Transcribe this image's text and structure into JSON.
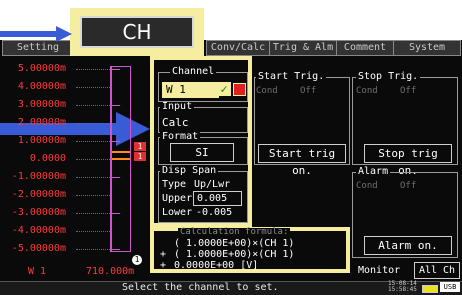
{
  "ch_button": {
    "label": "CH"
  },
  "tabs": [
    {
      "label": "Setting"
    },
    {
      "label": "Conv/Calc"
    },
    {
      "label": "Trig & Alm"
    },
    {
      "label": "Comment"
    },
    {
      "label": "System"
    }
  ],
  "y_axis": {
    "labels": [
      "5.00000m",
      "4.00000m",
      "3.00000m",
      "2.00000m",
      "1.00000m",
      "0.0000",
      "-1.00000m",
      "-2.00000m",
      "-3.00000m",
      "-4.00000m",
      "-5.00000m"
    ]
  },
  "trace": {
    "channel_label": "W 1",
    "value": "710.000m"
  },
  "markers": {
    "marker_1": "1",
    "marker_2": "1",
    "bottom_marker": "1"
  },
  "channel_panel": {
    "legend": "Channel",
    "value": "W  1",
    "check_glyph": "✓",
    "input_legend": "Input",
    "input_value": "Calc",
    "format_legend": "Format",
    "format_value": "SI",
    "disp_span_legend": "Disp Span",
    "type_label": "Type",
    "type_value": "Up/Lwr",
    "upper_label": "Upper",
    "upper_value": "0.005",
    "lower_label": "Lower",
    "lower_value": "-0.005"
  },
  "start_trig": {
    "legend": "Start Trig.",
    "cond_label": "Cond",
    "cond_value": "Off",
    "button": "Start trig on."
  },
  "stop_trig": {
    "legend": "Stop Trig.",
    "cond_label": "Cond",
    "cond_value": "Off",
    "button": "Stop trig on."
  },
  "alarm": {
    "legend": "Alarm",
    "cond_label": "Cond",
    "cond_value": "Off",
    "button": "Alarm on."
  },
  "formula": {
    "legend": "Calculation formula:",
    "lines": [
      "( 1.0000E+00)×(CH 1)",
      "( 1.0000E+00)×(CH 1)",
      "0.0000E+00 [V]"
    ],
    "operators": [
      "",
      "+",
      "+"
    ]
  },
  "monitor": {
    "label": "Monitor",
    "all_ch": "All Ch"
  },
  "status_bar": {
    "message": "Select the channel to set.",
    "date": "15-08-14",
    "time": "15:58:45",
    "usb_label": "USB"
  },
  "colors": {
    "highlight": "#f5eea0",
    "arrow": "#3a5bd6",
    "axis_label": "#ff3a3a",
    "trace": "#ff8a1a",
    "magenta": "#cc55cc"
  }
}
